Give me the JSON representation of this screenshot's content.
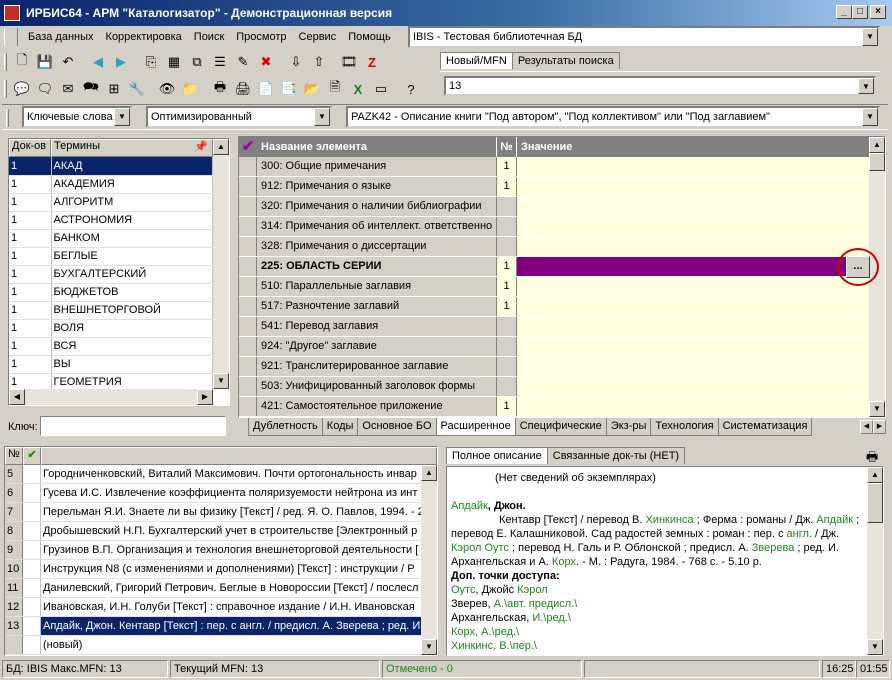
{
  "window": {
    "title": "ИРБИС64 - АРМ \"Каталогизатор\" - Демонстрационная версия"
  },
  "menu": [
    "База данных",
    "Корректировка",
    "Поиск",
    "Просмотр",
    "Сервис",
    "Помощь"
  ],
  "db_combo": {
    "value": "IBIS - Тестовая библиотечная БД"
  },
  "top_tabs": [
    "Новый/MFN",
    "Результаты поиска"
  ],
  "mfn_combo": {
    "value": "13"
  },
  "search_mode": {
    "value": "Ключевые слова"
  },
  "optimize": {
    "value": "Оптимизированный"
  },
  "worksheet": {
    "value": "PAZK42 - Описание книги \"Под автором\", \"Под коллективом\" или \"Под заглавием\""
  },
  "terms": {
    "headers": [
      "Док-ов",
      "Термины"
    ],
    "rows": [
      [
        "1",
        "АКАД"
      ],
      [
        "1",
        "АКАДЕМИЯ"
      ],
      [
        "1",
        "АЛГОРИТМ"
      ],
      [
        "1",
        "АСТРОНОМИЯ"
      ],
      [
        "1",
        "БАНКОМ"
      ],
      [
        "1",
        "БЕГЛЫЕ"
      ],
      [
        "1",
        "БУХГАЛТЕРСКИЙ"
      ],
      [
        "1",
        "БЮДЖЕТОВ"
      ],
      [
        "1",
        "ВНЕШНЕТОРГОВОЙ"
      ],
      [
        "1",
        "ВОЛЯ"
      ],
      [
        "1",
        "ВСЯ"
      ],
      [
        "1",
        "ВЫ"
      ],
      [
        "1",
        "ГЕОМЕТРИЯ"
      ]
    ],
    "key_label": "Ключ:"
  },
  "fields": {
    "headers": [
      "Название элемента",
      "№",
      "Значение"
    ],
    "rows": [
      [
        "300: Общие примечания",
        "1"
      ],
      [
        "912: Примечания о языке",
        "1"
      ],
      [
        "320: Примечания о наличии библиографии",
        ""
      ],
      [
        "314: Примечания об интеллект. ответственно",
        ""
      ],
      [
        "328: Примечания о диссертации",
        ""
      ],
      [
        "225: ОБЛАСТЬ СЕРИИ",
        "1"
      ],
      [
        "510: Параллельные заглавия",
        "1"
      ],
      [
        "517: Разночтение заглавий",
        "1"
      ],
      [
        "541: Перевод заглавия",
        ""
      ],
      [
        "924: \"Другое\" заглавие",
        ""
      ],
      [
        "921: Транслитерированное заглавие",
        ""
      ],
      [
        "503: Унифицированный заголовок формы",
        ""
      ],
      [
        "421: Самостоятельное приложение",
        "1"
      ]
    ],
    "ellipsis": "..."
  },
  "bottom_tabs": [
    "Дублетность",
    "Коды",
    "Основное БО",
    "Расширенное",
    "Специфические",
    "Экз-ры",
    "Технология",
    "Систематизация"
  ],
  "records": {
    "headers": [
      "№",
      "✔"
    ],
    "rows": [
      [
        "5",
        "Городниченковский, Виталий Максимович. Почти ортогональность инвар"
      ],
      [
        "6",
        "Гусева И.С. Извлечение коэффициента поляризуемости нейтрона из инт"
      ],
      [
        "7",
        "Перельман Я.И. Знаете ли вы физику [Текст] / ред. Я. О. Павлов, 1994. - 2"
      ],
      [
        "8",
        "Дробышевский Н.П. Бухгалтерский учет в строительстве [Электронный р"
      ],
      [
        "9",
        "Грузинов В.П. Организация и технология внешнеторговой деятельности ["
      ],
      [
        "10",
        "Инструкция N8   (с изменениями и дополнениями) [Текст] : инструкции / Р"
      ],
      [
        "11",
        "Данилевский, Григорий Петрович. Беглые в Новороссии [Текст] / послесл"
      ],
      [
        "12",
        "Ивановская, И.Н. Голуби [Текст] : справочное издание / И.Н. Ивановская"
      ],
      [
        "13",
        "Апдайк, Джон. Кентавр [Текст] : пер. с англ. / предисл. А. Зверева ; ред. И"
      ],
      [
        "",
        "(новый)"
      ]
    ]
  },
  "desc_tabs": [
    "Полное описание",
    "Связанные док-ты (НЕТ)"
  ],
  "description": {
    "no_copies": "(Нет сведений об экземплярах)",
    "author_link": "Апдайк",
    "author_rest": ", Джон.",
    "body": [
      {
        "t": "Кентавр [Текст] / перевод В. ",
        "g": false
      },
      {
        "t": "Хинкинса",
        "g": true
      },
      {
        "t": " ; Ферма : романы / Дж. ",
        "g": false
      },
      {
        "t": "Апдайк",
        "g": true
      },
      {
        "t": " ; перевод Е. Калашниковой. Сад радостей земных : роман : пер. с ",
        "g": false
      },
      {
        "t": "англ.",
        "g": true
      },
      {
        "t": " / Дж. ",
        "g": false
      },
      {
        "t": "Кэрол Оутс",
        "g": true
      },
      {
        "t": " ; перевод Н. Галь и Р. Облонской ; предисл. А. ",
        "g": false
      },
      {
        "t": "Зверева",
        "g": true
      },
      {
        "t": " ; ред. И. Архангельская и А. ",
        "g": false
      },
      {
        "t": "Корх",
        "g": true
      },
      {
        "t": ". - М. : Радуга, 1984. - 768 с. - 5.10 р.",
        "g": false
      }
    ],
    "access_title": "Доп. точки доступа:",
    "access": [
      [
        {
          "t": "Оутс",
          "g": true
        },
        {
          "t": ", Джойс ",
          "g": false
        },
        {
          "t": "Кэрол",
          "g": true
        }
      ],
      [
        {
          "t": "Зверев, ",
          "g": false
        },
        {
          "t": "А.\\авт. предисл.\\",
          "g": true
        }
      ],
      [
        {
          "t": "Архангельская, ",
          "g": false
        },
        {
          "t": "И.\\ред.\\",
          "g": true
        }
      ],
      [
        {
          "t": "Корх, А.\\ред.\\",
          "g": true
        }
      ],
      [
        {
          "t": "Хинкинс, В.\\пер.\\",
          "g": true
        }
      ]
    ]
  },
  "status": {
    "db": "БД: IBIS Макс.MFN: 13",
    "current": "Текущий MFN: 13",
    "marked": "Отмечено - 0",
    "time1": "16:25",
    "time2": "01:55"
  },
  "colors": {
    "selection": "#0a246a",
    "field_selected": "#800080",
    "value_bg": "#ffffe0",
    "link": "#1a8a1a",
    "marked": "#1a8a1a",
    "highlight": "#cc0000"
  }
}
